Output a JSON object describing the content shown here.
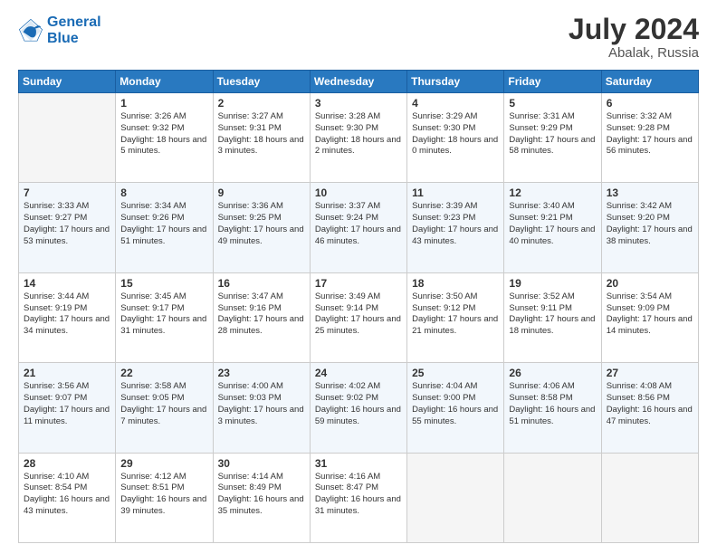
{
  "header": {
    "logo_line1": "General",
    "logo_line2": "Blue",
    "month_year": "July 2024",
    "location": "Abalak, Russia"
  },
  "weekdays": [
    "Sunday",
    "Monday",
    "Tuesday",
    "Wednesday",
    "Thursday",
    "Friday",
    "Saturday"
  ],
  "weeks": [
    [
      {
        "day": "",
        "sunrise": "",
        "sunset": "",
        "daylight": ""
      },
      {
        "day": "1",
        "sunrise": "Sunrise: 3:26 AM",
        "sunset": "Sunset: 9:32 PM",
        "daylight": "Daylight: 18 hours and 5 minutes."
      },
      {
        "day": "2",
        "sunrise": "Sunrise: 3:27 AM",
        "sunset": "Sunset: 9:31 PM",
        "daylight": "Daylight: 18 hours and 3 minutes."
      },
      {
        "day": "3",
        "sunrise": "Sunrise: 3:28 AM",
        "sunset": "Sunset: 9:30 PM",
        "daylight": "Daylight: 18 hours and 2 minutes."
      },
      {
        "day": "4",
        "sunrise": "Sunrise: 3:29 AM",
        "sunset": "Sunset: 9:30 PM",
        "daylight": "Daylight: 18 hours and 0 minutes."
      },
      {
        "day": "5",
        "sunrise": "Sunrise: 3:31 AM",
        "sunset": "Sunset: 9:29 PM",
        "daylight": "Daylight: 17 hours and 58 minutes."
      },
      {
        "day": "6",
        "sunrise": "Sunrise: 3:32 AM",
        "sunset": "Sunset: 9:28 PM",
        "daylight": "Daylight: 17 hours and 56 minutes."
      }
    ],
    [
      {
        "day": "7",
        "sunrise": "Sunrise: 3:33 AM",
        "sunset": "Sunset: 9:27 PM",
        "daylight": "Daylight: 17 hours and 53 minutes."
      },
      {
        "day": "8",
        "sunrise": "Sunrise: 3:34 AM",
        "sunset": "Sunset: 9:26 PM",
        "daylight": "Daylight: 17 hours and 51 minutes."
      },
      {
        "day": "9",
        "sunrise": "Sunrise: 3:36 AM",
        "sunset": "Sunset: 9:25 PM",
        "daylight": "Daylight: 17 hours and 49 minutes."
      },
      {
        "day": "10",
        "sunrise": "Sunrise: 3:37 AM",
        "sunset": "Sunset: 9:24 PM",
        "daylight": "Daylight: 17 hours and 46 minutes."
      },
      {
        "day": "11",
        "sunrise": "Sunrise: 3:39 AM",
        "sunset": "Sunset: 9:23 PM",
        "daylight": "Daylight: 17 hours and 43 minutes."
      },
      {
        "day": "12",
        "sunrise": "Sunrise: 3:40 AM",
        "sunset": "Sunset: 9:21 PM",
        "daylight": "Daylight: 17 hours and 40 minutes."
      },
      {
        "day": "13",
        "sunrise": "Sunrise: 3:42 AM",
        "sunset": "Sunset: 9:20 PM",
        "daylight": "Daylight: 17 hours and 38 minutes."
      }
    ],
    [
      {
        "day": "14",
        "sunrise": "Sunrise: 3:44 AM",
        "sunset": "Sunset: 9:19 PM",
        "daylight": "Daylight: 17 hours and 34 minutes."
      },
      {
        "day": "15",
        "sunrise": "Sunrise: 3:45 AM",
        "sunset": "Sunset: 9:17 PM",
        "daylight": "Daylight: 17 hours and 31 minutes."
      },
      {
        "day": "16",
        "sunrise": "Sunrise: 3:47 AM",
        "sunset": "Sunset: 9:16 PM",
        "daylight": "Daylight: 17 hours and 28 minutes."
      },
      {
        "day": "17",
        "sunrise": "Sunrise: 3:49 AM",
        "sunset": "Sunset: 9:14 PM",
        "daylight": "Daylight: 17 hours and 25 minutes."
      },
      {
        "day": "18",
        "sunrise": "Sunrise: 3:50 AM",
        "sunset": "Sunset: 9:12 PM",
        "daylight": "Daylight: 17 hours and 21 minutes."
      },
      {
        "day": "19",
        "sunrise": "Sunrise: 3:52 AM",
        "sunset": "Sunset: 9:11 PM",
        "daylight": "Daylight: 17 hours and 18 minutes."
      },
      {
        "day": "20",
        "sunrise": "Sunrise: 3:54 AM",
        "sunset": "Sunset: 9:09 PM",
        "daylight": "Daylight: 17 hours and 14 minutes."
      }
    ],
    [
      {
        "day": "21",
        "sunrise": "Sunrise: 3:56 AM",
        "sunset": "Sunset: 9:07 PM",
        "daylight": "Daylight: 17 hours and 11 minutes."
      },
      {
        "day": "22",
        "sunrise": "Sunrise: 3:58 AM",
        "sunset": "Sunset: 9:05 PM",
        "daylight": "Daylight: 17 hours and 7 minutes."
      },
      {
        "day": "23",
        "sunrise": "Sunrise: 4:00 AM",
        "sunset": "Sunset: 9:03 PM",
        "daylight": "Daylight: 17 hours and 3 minutes."
      },
      {
        "day": "24",
        "sunrise": "Sunrise: 4:02 AM",
        "sunset": "Sunset: 9:02 PM",
        "daylight": "Daylight: 16 hours and 59 minutes."
      },
      {
        "day": "25",
        "sunrise": "Sunrise: 4:04 AM",
        "sunset": "Sunset: 9:00 PM",
        "daylight": "Daylight: 16 hours and 55 minutes."
      },
      {
        "day": "26",
        "sunrise": "Sunrise: 4:06 AM",
        "sunset": "Sunset: 8:58 PM",
        "daylight": "Daylight: 16 hours and 51 minutes."
      },
      {
        "day": "27",
        "sunrise": "Sunrise: 4:08 AM",
        "sunset": "Sunset: 8:56 PM",
        "daylight": "Daylight: 16 hours and 47 minutes."
      }
    ],
    [
      {
        "day": "28",
        "sunrise": "Sunrise: 4:10 AM",
        "sunset": "Sunset: 8:54 PM",
        "daylight": "Daylight: 16 hours and 43 minutes."
      },
      {
        "day": "29",
        "sunrise": "Sunrise: 4:12 AM",
        "sunset": "Sunset: 8:51 PM",
        "daylight": "Daylight: 16 hours and 39 minutes."
      },
      {
        "day": "30",
        "sunrise": "Sunrise: 4:14 AM",
        "sunset": "Sunset: 8:49 PM",
        "daylight": "Daylight: 16 hours and 35 minutes."
      },
      {
        "day": "31",
        "sunrise": "Sunrise: 4:16 AM",
        "sunset": "Sunset: 8:47 PM",
        "daylight": "Daylight: 16 hours and 31 minutes."
      },
      {
        "day": "",
        "sunrise": "",
        "sunset": "",
        "daylight": ""
      },
      {
        "day": "",
        "sunrise": "",
        "sunset": "",
        "daylight": ""
      },
      {
        "day": "",
        "sunrise": "",
        "sunset": "",
        "daylight": ""
      }
    ]
  ]
}
